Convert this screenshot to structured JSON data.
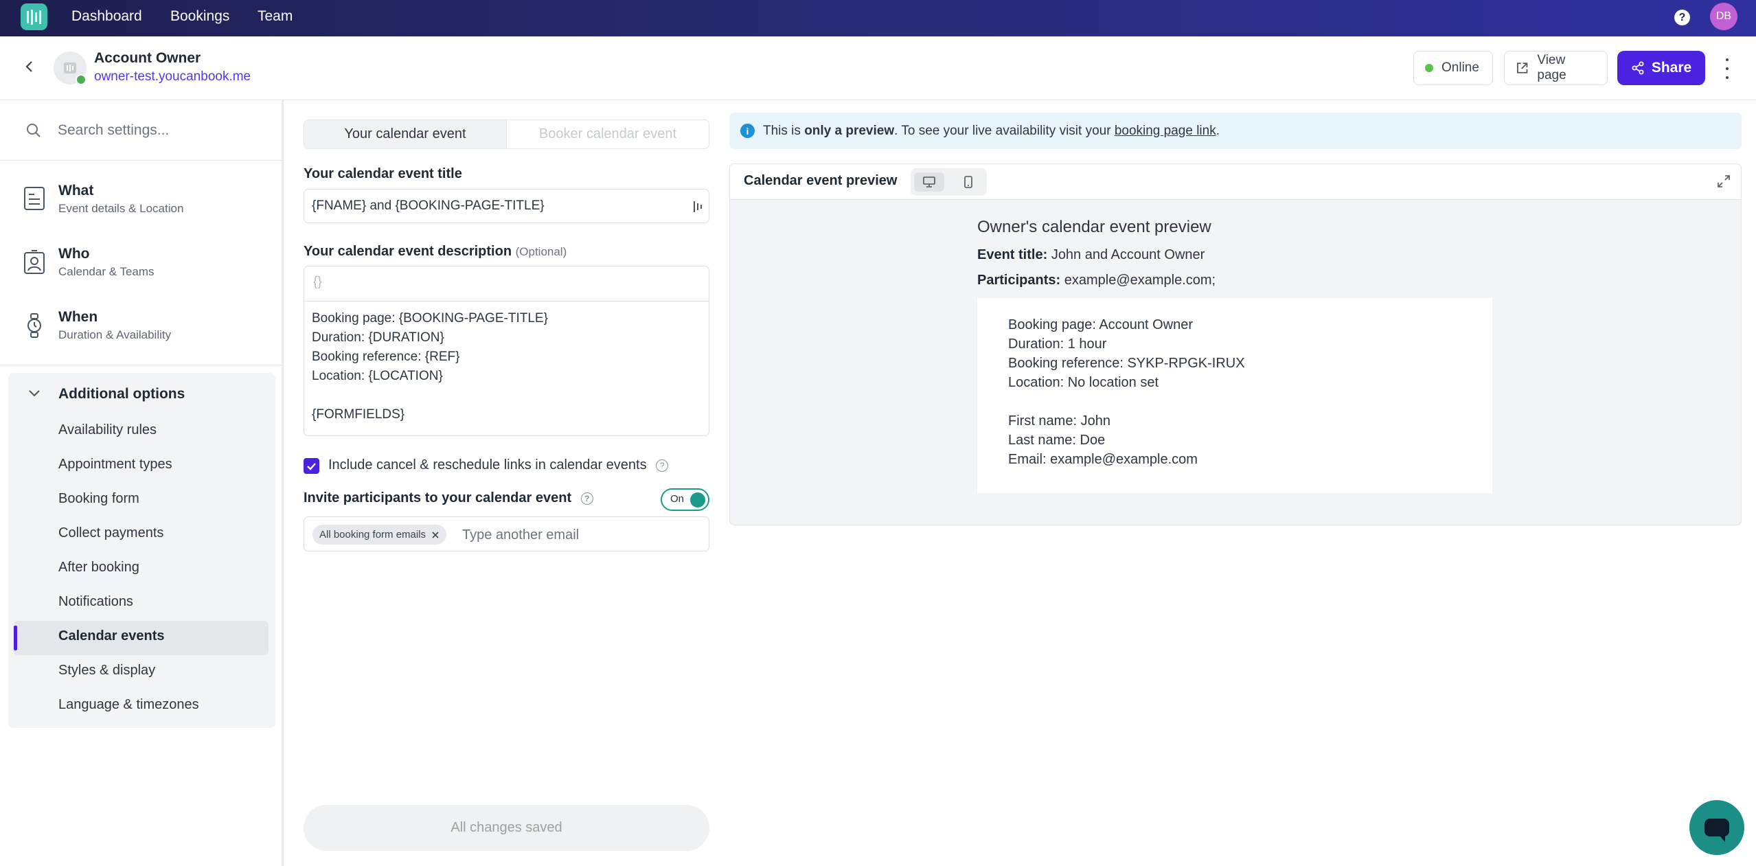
{
  "topnav": {
    "links": [
      "Dashboard",
      "Bookings",
      "Team"
    ],
    "avatar_initials": "DB",
    "help_icon": "?"
  },
  "header": {
    "title": "Account Owner",
    "url": "owner-test.youcanbook.me",
    "status_label": "Online",
    "view_page_label": "View page",
    "share_label": "Share"
  },
  "sidebar": {
    "search_placeholder": "Search settings...",
    "sections": [
      {
        "title": "What",
        "subtitle": "Event details & Location",
        "icon": "document-icon"
      },
      {
        "title": "Who",
        "subtitle": "Calendar & Teams",
        "icon": "contact-card-icon"
      },
      {
        "title": "When",
        "subtitle": "Duration & Availability",
        "icon": "watch-icon"
      }
    ],
    "additional_options": {
      "title": "Additional options",
      "items": [
        "Availability rules",
        "Appointment types",
        "Booking form",
        "Collect payments",
        "After booking",
        "Notifications",
        "Calendar events",
        "Styles & display",
        "Language & timezones"
      ],
      "active": "Calendar events"
    }
  },
  "editor": {
    "tabs": [
      "Your calendar event",
      "Booker calendar event"
    ],
    "active_tab": "Your calendar event",
    "title_label": "Your calendar event title",
    "title_value": "{FNAME} and {BOOKING-PAGE-TITLE}",
    "description_label": "Your calendar event description",
    "description_optional": "(Optional)",
    "description_toolbar": "{}",
    "description_value": "Booking page: {BOOKING-PAGE-TITLE}\nDuration: {DURATION}\nBooking reference: {REF}\nLocation: {LOCATION}\n\n{FORMFIELDS}",
    "include_links_label": "Include cancel & reschedule links in calendar events",
    "include_links_checked": true,
    "invite_label": "Invite participants to your calendar event",
    "invite_toggle_label": "On",
    "invite_toggle_on": true,
    "email_chip": "All booking form emails",
    "email_placeholder": "Type another email",
    "save_status": "All changes saved"
  },
  "preview": {
    "banner_prefix": "This is ",
    "banner_bold": "only a preview",
    "banner_middle": ". To see your live availability visit your ",
    "banner_link": "booking page link",
    "banner_suffix": ".",
    "card_title": "Calendar event preview",
    "heading": "Owner's calendar event preview",
    "event_title_label": "Event title:",
    "event_title_value": "John and Account Owner",
    "participants_label": "Participants:",
    "participants_value": "example@example.com;",
    "body": "Booking page: Account Owner\nDuration: 1 hour\nBooking reference: SYKP-RPGK-IRUX\nLocation: No location set\n\nFirst name: John\nLast name: Doe\nEmail: example@example.com"
  },
  "colors": {
    "accent": "#4a22e0",
    "teal": "#1b9a8c",
    "nav_bg": "#24276a"
  }
}
